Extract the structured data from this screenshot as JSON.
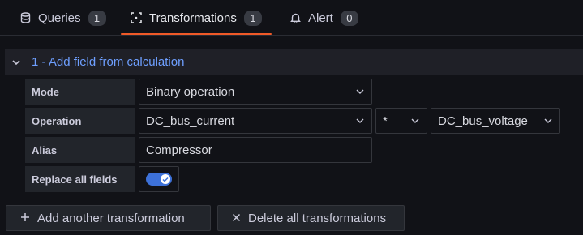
{
  "tabs": [
    {
      "label": "Queries",
      "count": "1",
      "icon": "database-icon"
    },
    {
      "label": "Transformations",
      "count": "1",
      "icon": "transform-icon",
      "active": true
    },
    {
      "label": "Alert",
      "count": "0",
      "icon": "bell-icon"
    }
  ],
  "transformation": {
    "header": "1 - Add field from calculation",
    "mode": {
      "label": "Mode",
      "value": "Binary operation"
    },
    "operation": {
      "label": "Operation",
      "left": "DC_bus_current",
      "operator": "*",
      "right": "DC_bus_voltage"
    },
    "alias": {
      "label": "Alias",
      "value": "Compressor"
    },
    "replace_all": {
      "label": "Replace all fields",
      "enabled": true
    }
  },
  "actions": {
    "add_label": "Add another transformation",
    "delete_label": "Delete all transformations"
  },
  "colors": {
    "background": "#111217",
    "accent_link": "#6e9fff",
    "active_tab_underline": "#f05a28",
    "switch_on": "#3d71d9"
  }
}
